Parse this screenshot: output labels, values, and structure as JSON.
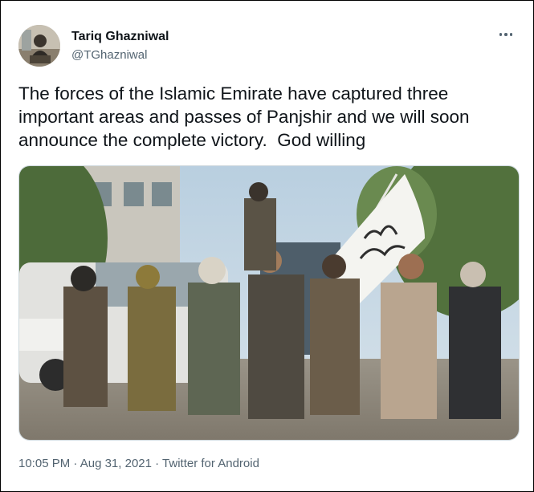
{
  "author": {
    "name": "Tariq Ghazniwal",
    "handle": "@TGhazniwal",
    "avatar_icon": "profile-photo"
  },
  "tweet": {
    "text": "The forces of the Islamic Emirate have captured three important areas and passes of Panjshir and we will soon announce the complete victory.  God willing"
  },
  "media": {
    "kind": "video-frame",
    "flag_script": "لا إله إلا الله"
  },
  "meta": {
    "time": "10:05 PM",
    "sep1": " · ",
    "date": "Aug 31, 2021",
    "sep2": " · ",
    "source": "Twitter for Android"
  },
  "icons": {
    "more": "more-horizontal-icon"
  },
  "colors": {
    "text": "#0f1419",
    "secondary": "#536471",
    "border": "#cfd9de"
  }
}
